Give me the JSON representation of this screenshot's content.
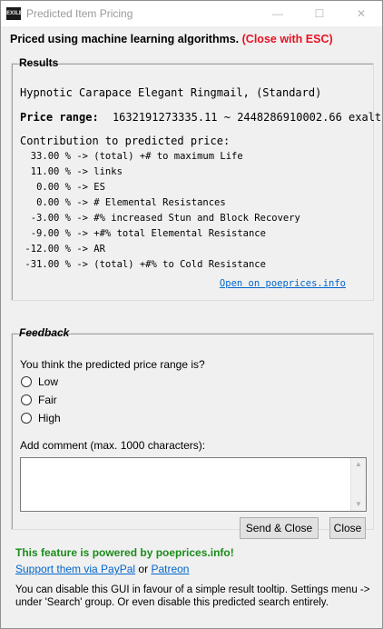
{
  "window": {
    "icon_text": "EXILE",
    "title": "Predicted Item Pricing",
    "minimize": "—",
    "maximize": "☐",
    "close": "✕"
  },
  "headline": {
    "text": "Priced using machine learning algorithms.",
    "esc_text": "(Close with ESC)"
  },
  "results": {
    "legend": "Results",
    "item_name": "Hypnotic Carapace Elegant Ringmail, (Standard)",
    "price_label": "Price range:",
    "price_value": "1632191273335.11 ~ 2448286910002.66 exalt",
    "contrib_title": "Contribution to predicted price:",
    "contributions": [
      {
        "pct": "33.00 %",
        "text": "-> (total) +# to maximum Life"
      },
      {
        "pct": "11.00 %",
        "text": "-> links"
      },
      {
        "pct": "0.00 %",
        "text": "-> ES"
      },
      {
        "pct": "0.00 %",
        "text": "-> # Elemental Resistances"
      },
      {
        "pct": "-3.00 %",
        "text": "-> #% increased Stun and Block Recovery"
      },
      {
        "pct": "-9.00 %",
        "text": "-> +#% total Elemental Resistance"
      },
      {
        "pct": "-12.00 %",
        "text": "-> AR"
      },
      {
        "pct": "-31.00 %",
        "text": "-> (total) +#% to Cold Resistance"
      }
    ],
    "open_link": "Open on poeprices.info"
  },
  "feedback": {
    "legend": "Feedback",
    "question": "You think the predicted price range is?",
    "options": [
      "Low",
      "Fair",
      "High"
    ],
    "comment_label": "Add comment (max. 1000 characters):",
    "comment_value": "",
    "send_button": "Send & Close",
    "close_button": "Close"
  },
  "footer": {
    "powered": "This feature is powered by poeprices.info!",
    "support_link": "Support them via PayPal",
    "or_text": "or",
    "patreon_link": "Patreon",
    "note": "You can disable this GUI in favour of a simple result tooltip. Settings menu -> under 'Search' group. Or even disable this predicted search entirely."
  },
  "colors": {
    "accent_red": "#e81123",
    "powered_green": "#1a8c1a",
    "link_blue": "#0066cc"
  }
}
